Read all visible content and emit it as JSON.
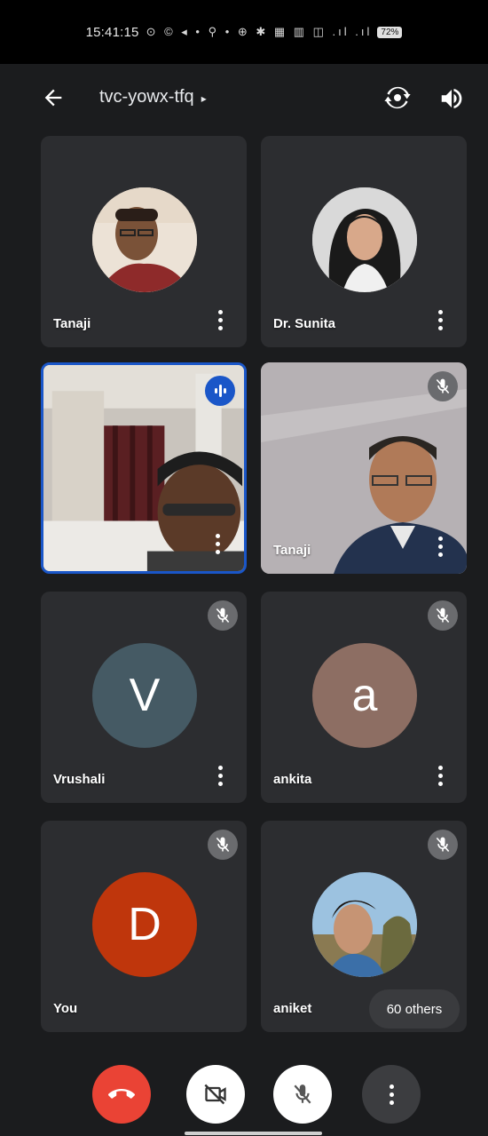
{
  "status_bar": {
    "time": "15:41:15",
    "icons_text": "⊙ © ◂ • ⚲ •   ⊕ ✱ ▦ ▥ ◫ .ıl .ıl",
    "battery": "72%"
  },
  "header": {
    "meeting_code": "tvc-yowx-tfq",
    "caret": "▸",
    "icons": [
      "back-arrow-icon",
      "switch-camera-icon",
      "speaker-icon"
    ]
  },
  "participants": [
    {
      "name": "Tanaji",
      "type": "photo",
      "muted": false
    },
    {
      "name": "Dr. Sunita",
      "type": "photo",
      "muted": false
    },
    {
      "name": "",
      "type": "video",
      "speaking": true
    },
    {
      "name": "Tanaji",
      "type": "video",
      "muted": true
    },
    {
      "name": "Vrushali",
      "type": "initial",
      "initial": "V",
      "color": "#455a64",
      "muted": true
    },
    {
      "name": "ankita",
      "type": "initial",
      "initial": "a",
      "color": "#8d6e63",
      "muted": true
    },
    {
      "name": "You",
      "type": "initial",
      "initial": "D",
      "color": "#bf360c",
      "muted": true
    },
    {
      "name": "aniket",
      "type": "photo",
      "muted": true
    }
  ],
  "others_badge": "60 others",
  "controls": {
    "end_call_color": "#ea4335",
    "icons": [
      "end-call-icon",
      "camera-off-icon",
      "mic-off-icon",
      "more-options-icon"
    ]
  },
  "colors": {
    "background": "#1b1c1e",
    "tile": "#2c2d30",
    "active_border": "#1a56c8"
  }
}
